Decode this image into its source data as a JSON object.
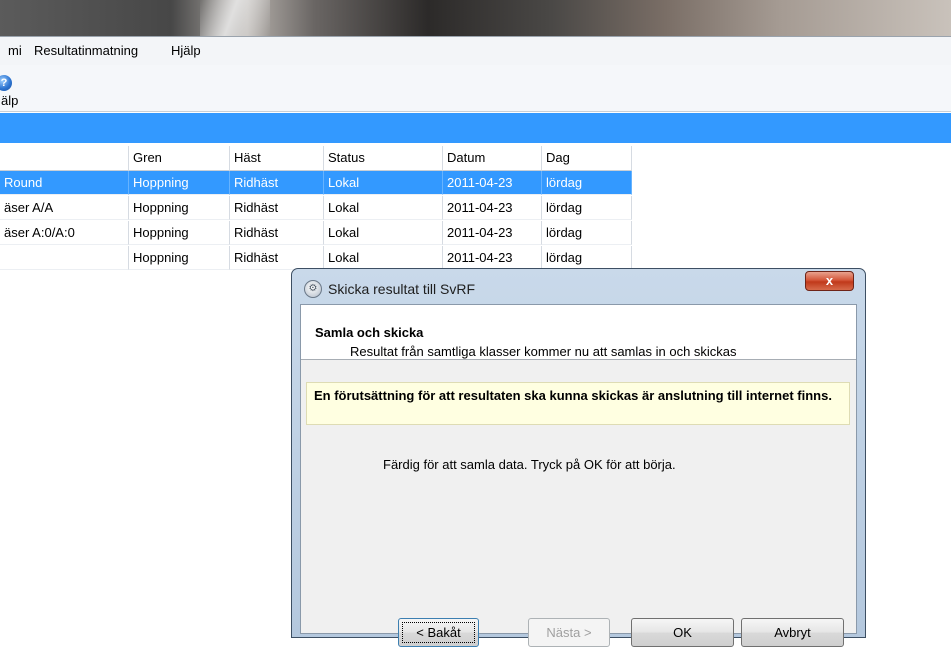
{
  "menubar": {
    "items": [
      "mi",
      "Resultatinmatning",
      "Hjälp"
    ]
  },
  "toolbar": {
    "help_label": "älp",
    "help_glyph": "?"
  },
  "grid": {
    "columns": [
      "Gren",
      "Häst",
      "Status",
      "Datum",
      "Dag"
    ],
    "rows": [
      {
        "name": "Round",
        "gren": "Hoppning",
        "hast": "Ridhäst",
        "status": "Lokal",
        "datum": "2011-04-23",
        "dag": "lördag"
      },
      {
        "name": "äser A/A",
        "gren": "Hoppning",
        "hast": "Ridhäst",
        "status": "Lokal",
        "datum": "2011-04-23",
        "dag": "lördag"
      },
      {
        "name": "äser A:0/A:0",
        "gren": "Hoppning",
        "hast": "Ridhäst",
        "status": "Lokal",
        "datum": "2011-04-23",
        "dag": "lördag"
      },
      {
        "name": "",
        "gren": "Hoppning",
        "hast": "Ridhäst",
        "status": "Lokal",
        "datum": "2011-04-23",
        "dag": "lördag"
      }
    ]
  },
  "dialog": {
    "title": "Skicka resultat till SvRF",
    "close_glyph": "x",
    "header_title": "Samla och skicka",
    "header_subtitle": "Resultat från samtliga klasser kommer nu att samlas in och skickas",
    "note": "En förutsättning för att resultaten ska kunna skickas är anslutning till internet finns.",
    "status": "Färdig för att samla data. Tryck på OK för att börja.",
    "buttons": {
      "back": "< Bakåt",
      "next": "Nästa >",
      "ok": "OK",
      "cancel": "Avbryt"
    }
  },
  "colors": {
    "selection": "#3399ff",
    "note_bg": "#ffffe1",
    "close_red": "#c0391b"
  }
}
